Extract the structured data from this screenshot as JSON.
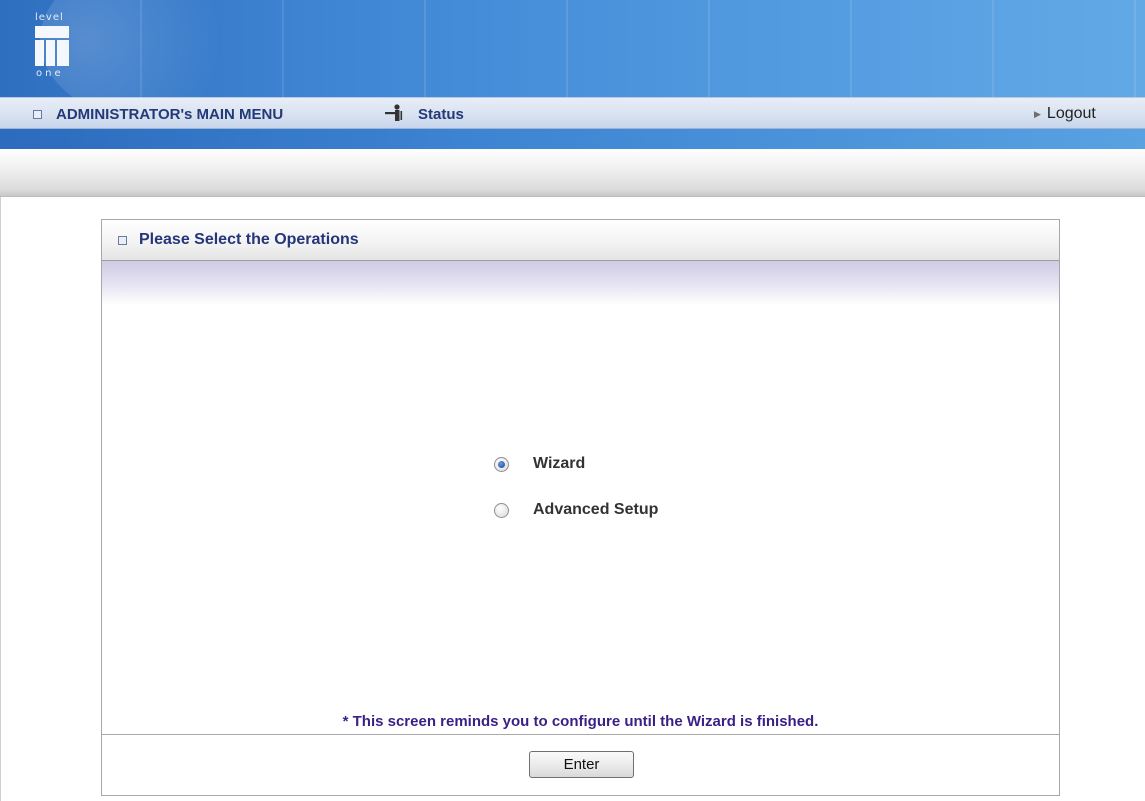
{
  "logo": {
    "top_text": "level",
    "bottom_text": "one"
  },
  "menu": {
    "admin_label": "ADMINISTRATOR's MAIN MENU",
    "status_label": "Status",
    "logout_label": "Logout"
  },
  "panel": {
    "title": "Please Select the Operations",
    "options": [
      {
        "label": "Wizard",
        "selected": true
      },
      {
        "label": "Advanced Setup",
        "selected": false
      }
    ],
    "reminder": "* This screen reminds you to configure until the Wizard is finished.",
    "enter_label": "Enter"
  },
  "colors": {
    "header_blue": "#3f86d4",
    "menu_text": "#233978",
    "reminder_text": "#3a1f86"
  }
}
